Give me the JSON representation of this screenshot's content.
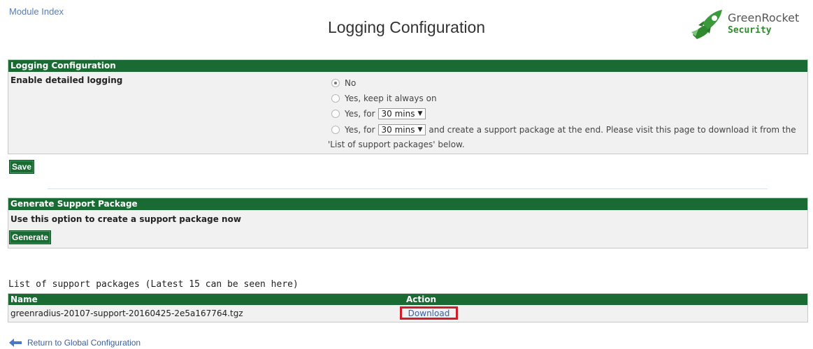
{
  "header": {
    "module_index": "Module Index",
    "title": "Logging Configuration",
    "logo": {
      "line1": "GreenRocket",
      "line2": "Security"
    }
  },
  "logging": {
    "header": "Logging Configuration",
    "label": "Enable detailed logging",
    "options": {
      "no": "No",
      "always": "Yes, keep it always on",
      "for_prefix": "Yes, for",
      "for_select": "30 mins",
      "package_prefix": "Yes, for",
      "package_select": "30 mins",
      "package_suffix": "and create a support package at the end. Please visit this page to download it from the",
      "package_suffix2": "'List of support packages' below."
    },
    "selected": "No",
    "save": "Save"
  },
  "generate": {
    "header": "Generate Support Package",
    "text": "Use this option to create a support package now",
    "button": "Generate"
  },
  "packages": {
    "title": "List of support packages (Latest 15 can be seen here)",
    "columns": [
      "Name",
      "Action"
    ],
    "rows": [
      {
        "name": "greenradius-20107-support-20160425-2e5a167764.tgz",
        "action": "Download"
      }
    ]
  },
  "footer": {
    "return": "Return to Global Configuration"
  },
  "colors": {
    "header_green": "#1a6b33",
    "highlight_red": "#d11c2a",
    "link_blue": "#3a5f9e"
  }
}
